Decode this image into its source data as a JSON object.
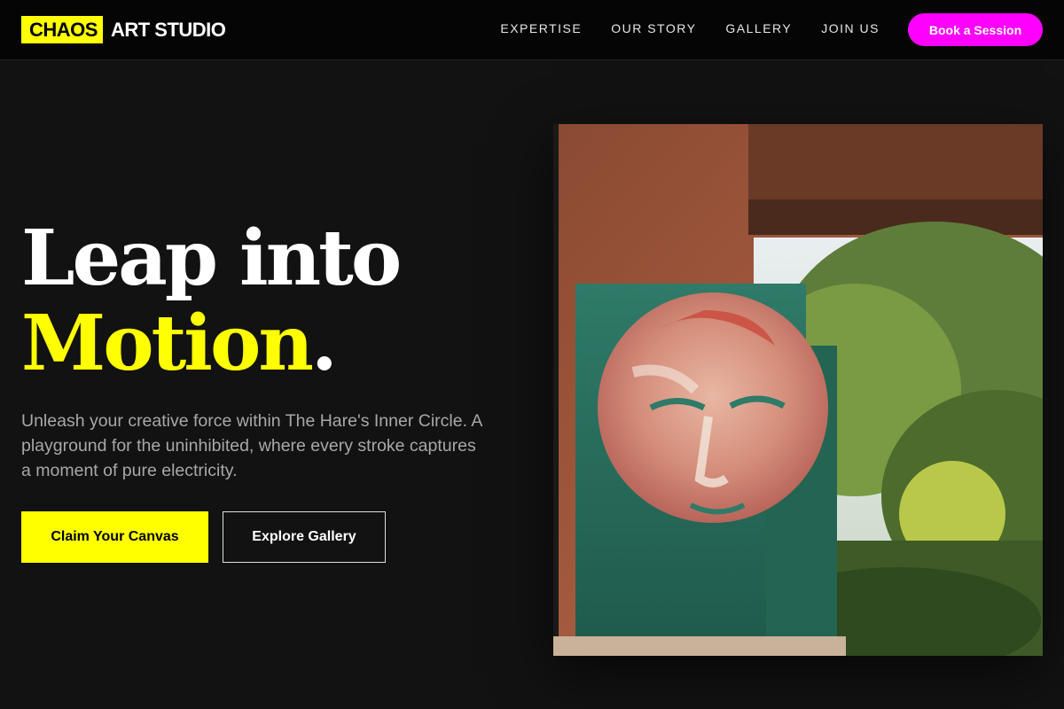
{
  "brand": {
    "tag": "CHAOS",
    "name": "ART STUDIO"
  },
  "nav": {
    "links": [
      "EXPERTISE",
      "OUR STORY",
      "GALLERY",
      "JOIN US"
    ],
    "cta": "Book a Session"
  },
  "hero": {
    "title_line1": "Leap into",
    "title_accent": "Motion",
    "title_dot": ".",
    "description": "Unleash your creative force within The Hare's Inner Circle. A playground for the uninhibited, where every stroke captures a moment of pure electricity.",
    "primary_button": "Claim Your Canvas",
    "secondary_button": "Explore Gallery"
  },
  "image": {
    "alt": "Painted face artwork on rusted metal panel in a garden"
  },
  "colors": {
    "accent_yellow": "#ffff00",
    "accent_magenta": "#ff00ff",
    "background": "#121212"
  }
}
